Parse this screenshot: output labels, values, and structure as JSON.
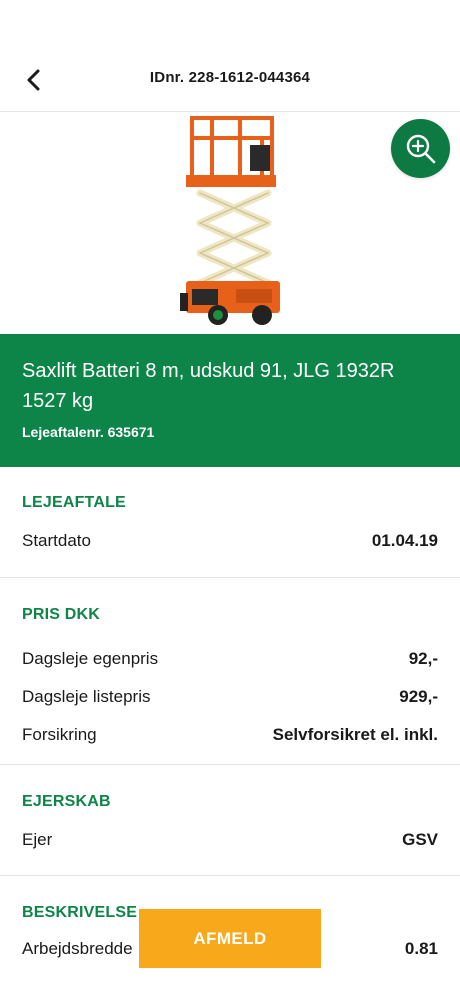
{
  "header": {
    "title": "IDnr. 228-1612-044364"
  },
  "product": {
    "name": "Saxlift Batteri 8 m, udskud 91, JLG 1932R 1527 kg",
    "agreement": "Lejeaftalenr. 635671"
  },
  "sections": {
    "lejeaftale": {
      "heading": "LEJEAFTALE",
      "rows": [
        {
          "label": "Startdato",
          "value": "01.04.19"
        }
      ]
    },
    "pris": {
      "heading": "PRIS DKK",
      "rows": [
        {
          "label": "Dagsleje egenpris",
          "value": "92,-"
        },
        {
          "label": "Dagsleje listepris",
          "value": "929,-"
        },
        {
          "label": "Forsikring",
          "value": "Selvforsikret el. inkl."
        }
      ]
    },
    "ejerskab": {
      "heading": "EJERSKAB",
      "rows": [
        {
          "label": "Ejer",
          "value": "GSV"
        }
      ]
    },
    "beskrivelse": {
      "heading": "BESKRIVELSE",
      "rows": [
        {
          "label": "Arbejdsbredde",
          "value": "0.81"
        }
      ]
    }
  },
  "actions": {
    "afmeld_label": "AFMELD"
  },
  "icons": {
    "back": "chevron-left-icon",
    "zoom": "zoom-in-icon"
  },
  "colors": {
    "brand_green": "#0d8549",
    "zoom_green": "#0d7a43",
    "accent_orange": "#f7a81b",
    "lift_orange": "#e8611a",
    "scissor_beige": "#efe6c2"
  }
}
